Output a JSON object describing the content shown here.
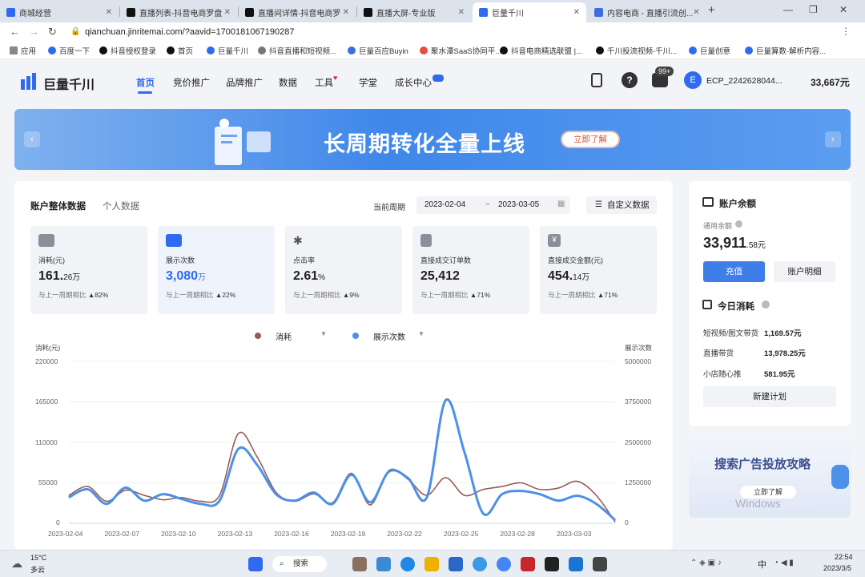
{
  "browser": {
    "tabs": [
      "商城经营",
      "直播列表-抖音电商罗盘",
      "直播间详情-抖音电商罗",
      "直播大屏-专业版",
      "巨量千川",
      "内容电商 - 直播引流创..."
    ],
    "url": "qianchuan.jinritemai.com/?aavid=1700181067190287",
    "bookmarks": [
      "应用",
      "百度一下",
      "抖音授权登录",
      "首页",
      "巨量千川",
      "抖音直播和短视频...",
      "巨量百应Buyin",
      "聚水潭SaaS协同平...",
      "抖音电商精选联盟 |...",
      "千川投流视频-千川...",
      "巨量创意",
      "巨量算数-解析内容..."
    ]
  },
  "app": {
    "logo_text": "巨量千川",
    "nav": [
      "首页",
      "竞价推广",
      "品牌推广",
      "数据",
      "工具",
      "学堂",
      "成长中心"
    ],
    "notification_badge": "99+",
    "account_initial": "E",
    "account_name": "ECP_2242628044...",
    "balance": "33,667元"
  },
  "banner": {
    "headline": "长周期转化全量上线",
    "cta": "立即了解"
  },
  "overview": {
    "tabs": [
      "账户整体数据",
      "个人数据"
    ],
    "period_label": "当前周期",
    "date_start": "2023-02-04",
    "date_sep": "~",
    "date_end": "2023-03-05",
    "custom_button": "自定义数据",
    "kpis": [
      {
        "label": "消耗(元)",
        "value": "161.",
        "value_small": "26万",
        "compare": "与上一周期相比",
        "delta": "▲82%",
        "color": "#8a8f99"
      },
      {
        "label": "展示次数",
        "value": "3,080",
        "value_small": "万",
        "compare": "与上一周期相比",
        "delta": "▲22%",
        "color": "#2f6bf0"
      },
      {
        "label": "点击率",
        "value": "2.61",
        "value_small": "%",
        "compare": "与上一周期相比",
        "delta": "▲9%",
        "color": "#8a8f99"
      },
      {
        "label": "直接成交订单数",
        "value": "25,412",
        "value_small": "",
        "compare": "与上一周期相比",
        "delta": "▲71%",
        "color": "#8a8f99"
      },
      {
        "label": "直接成交金额(元)",
        "value": "454.",
        "value_small": "14万",
        "compare": "与上一周期相比",
        "delta": "▲71%",
        "color": "#8a8f99"
      }
    ],
    "selectors": [
      "消耗",
      "展示次数"
    ]
  },
  "chart_data": {
    "type": "line",
    "ylabel": "消耗(元)",
    "y2label": "展示次数",
    "ylim": [
      0,
      220000
    ],
    "y2lim": [
      0,
      5000000
    ],
    "y_ticks": [
      "220000",
      "165000",
      "110000",
      "55000",
      "0"
    ],
    "y2_ticks": [
      "5000000",
      "3750000",
      "2500000",
      "1250000",
      "0"
    ],
    "x_tick_labels": [
      "2023-02-04",
      "2023-02-07",
      "2023-02-10",
      "2023-02-13",
      "2023-02-16",
      "2023-02-19",
      "2023-02-22",
      "2023-02-25",
      "2023-02-28",
      "2023-03-03"
    ],
    "x": [
      "2023-02-04",
      "2023-02-05",
      "2023-02-06",
      "2023-02-07",
      "2023-02-08",
      "2023-02-09",
      "2023-02-10",
      "2023-02-11",
      "2023-02-12",
      "2023-02-13",
      "2023-02-14",
      "2023-02-15",
      "2023-02-16",
      "2023-02-17",
      "2023-02-18",
      "2023-02-19",
      "2023-02-20",
      "2023-02-21",
      "2023-02-22",
      "2023-02-23",
      "2023-02-24",
      "2023-02-25",
      "2023-02-26",
      "2023-02-27",
      "2023-02-28",
      "2023-03-01",
      "2023-03-02",
      "2023-03-03",
      "2023-03-04",
      "2023-03-05"
    ],
    "series": [
      {
        "name": "消耗",
        "axis": "left",
        "color": "#9a5a55",
        "values": [
          38000,
          50000,
          30000,
          45000,
          38000,
          32000,
          35000,
          30000,
          38000,
          122000,
          90000,
          42000,
          30000,
          40000,
          28000,
          68000,
          25000,
          72000,
          60000,
          38000,
          62000,
          38000,
          46000,
          50000,
          55000,
          46000,
          48000,
          57000,
          38000,
          2000
        ]
      },
      {
        "name": "展示次数",
        "axis": "right",
        "color": "#4d90e8",
        "values": [
          800000,
          1050000,
          600000,
          1100000,
          700000,
          900000,
          750000,
          600000,
          700000,
          2300000,
          1800000,
          900000,
          700000,
          950000,
          600000,
          1500000,
          650000,
          1600000,
          1400000,
          800000,
          3800000,
          2200000,
          300000,
          900000,
          1000000,
          900000,
          700000,
          850000,
          600000,
          100000
        ]
      }
    ]
  },
  "balance_panel": {
    "title": "账户余额",
    "sub_label": "通用余额",
    "amount": "33,911",
    "amount_small": ".58元",
    "recharge_button": "充值",
    "detail_button": "账户明细"
  },
  "today_spend": {
    "title": "今日消耗",
    "rows": [
      {
        "label": "短视频/图文带货",
        "value": "1,169.57元"
      },
      {
        "label": "直播带货",
        "value": "13,978.25元"
      },
      {
        "label": "小店随心推",
        "value": "581.95元"
      }
    ],
    "new_plan_button": "新建计划"
  },
  "promo": {
    "title": "搜索广告投放攻略",
    "cta": "立即了解",
    "watermark": "Windows"
  },
  "taskbar": {
    "weather_temp": "15°C",
    "weather_desc": "多云",
    "search": "搜索",
    "time": "22:54",
    "date": "2023/3/5",
    "ime": "中"
  }
}
